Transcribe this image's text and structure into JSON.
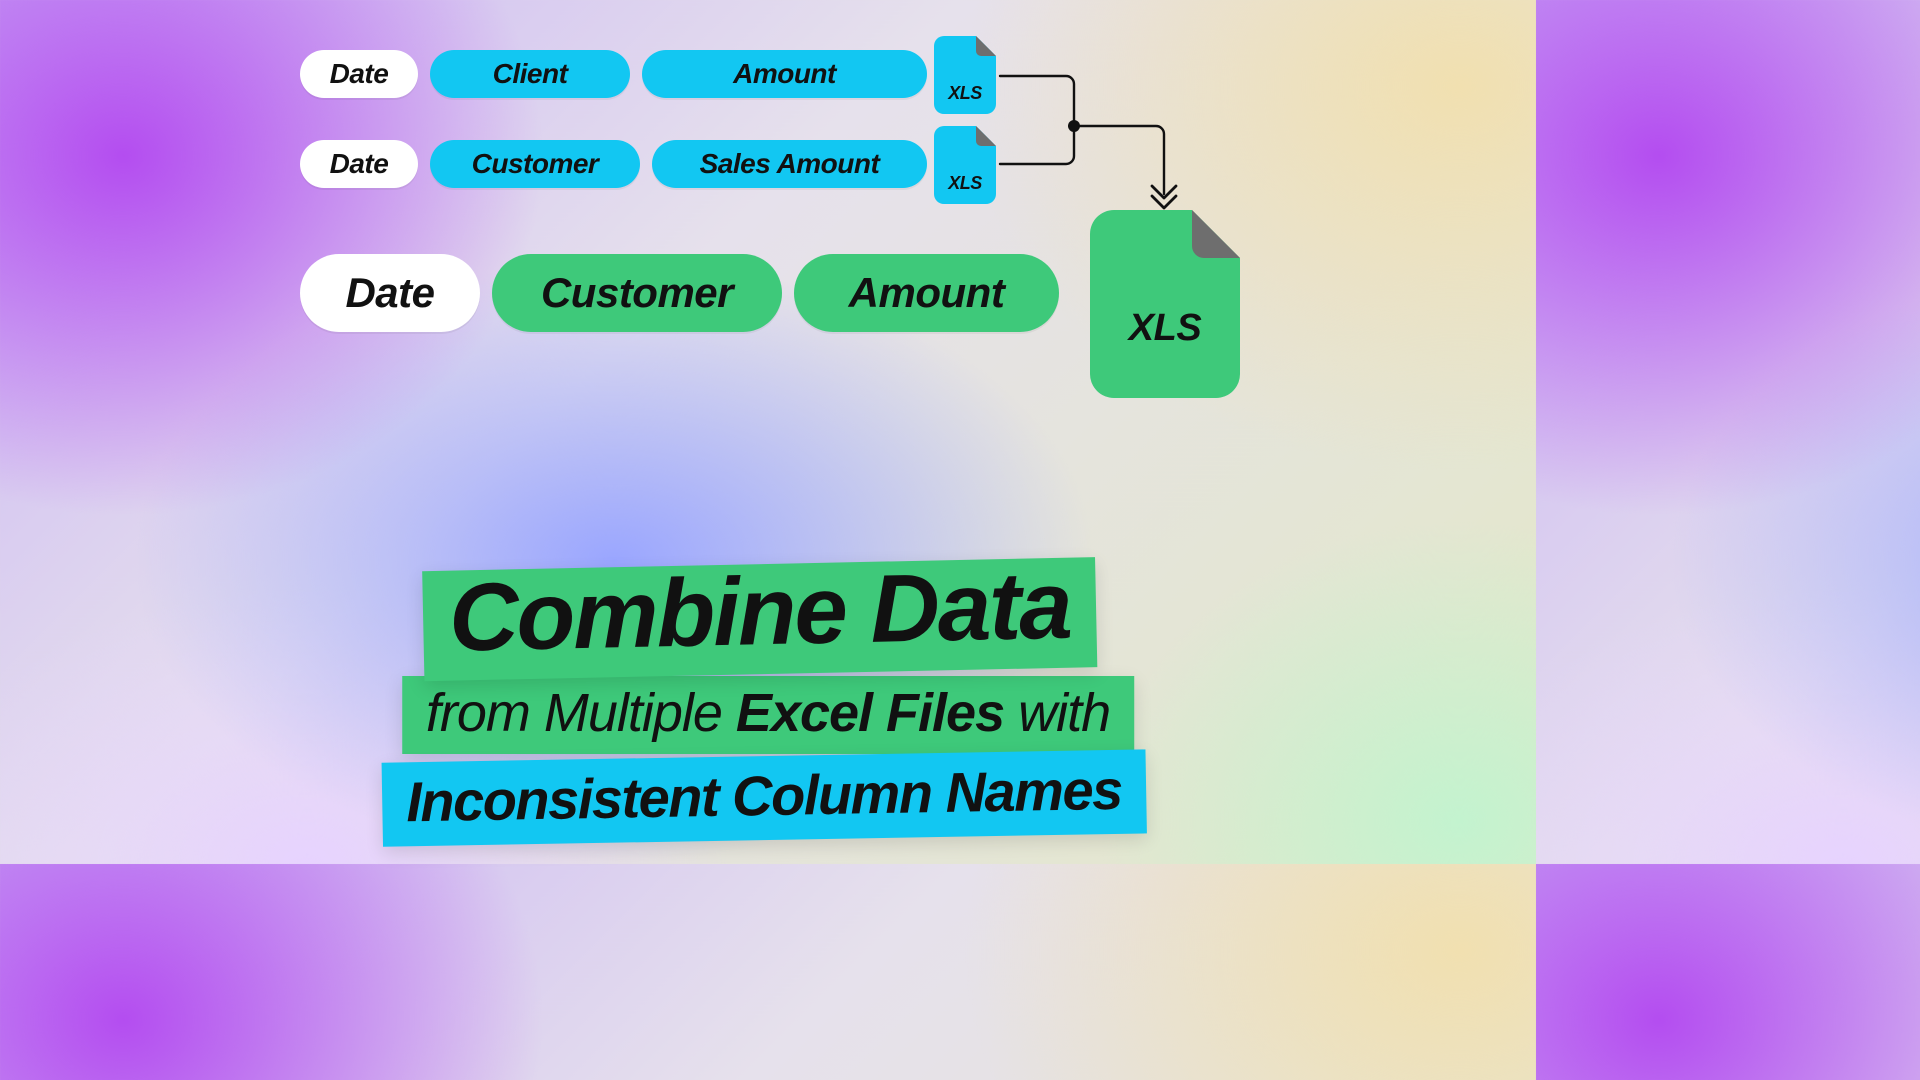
{
  "colors": {
    "cyan": "#12C7F2",
    "green": "#3EC97A",
    "white": "#FFFFFF",
    "gray_fold": "#6e6e6e"
  },
  "source_files": [
    {
      "columns": {
        "date": "Date",
        "party": "Client",
        "value": "Amount"
      },
      "file_label": "XLS",
      "file_color": "cyan"
    },
    {
      "columns": {
        "date": "Date",
        "party": "Customer",
        "value": "Sales Amount"
      },
      "file_label": "XLS",
      "file_color": "cyan"
    }
  ],
  "output_file": {
    "columns": {
      "date": "Date",
      "party": "Customer",
      "value": "Amount"
    },
    "file_label": "XLS",
    "file_color": "green"
  },
  "title": {
    "line1": "Combine Data",
    "line2_prefix": "from Multiple ",
    "line2_bold": "Excel Files",
    "line2_suffix": " with",
    "line3": "Inconsistent Column Names"
  }
}
